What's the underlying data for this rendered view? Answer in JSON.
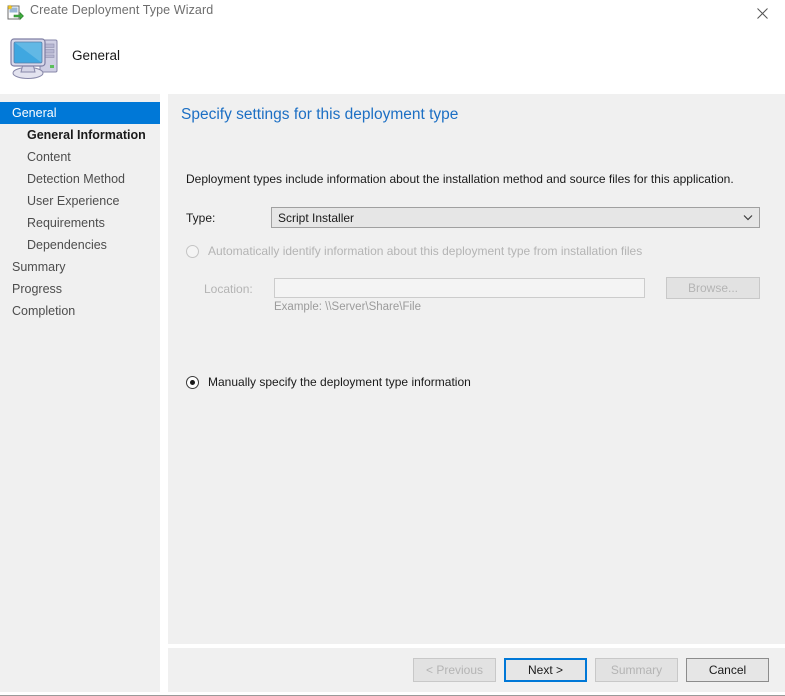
{
  "window": {
    "title": "Create Deployment Type Wizard",
    "title_icon": "wizard-document-icon",
    "close_icon": "close-icon"
  },
  "header": {
    "title": "General",
    "icon": "computer-icon"
  },
  "sidebar": {
    "items": [
      {
        "label": "General",
        "level": 0,
        "state": "selected"
      },
      {
        "label": "General Information",
        "level": 1,
        "state": "current"
      },
      {
        "label": "Content",
        "level": 1,
        "state": "normal"
      },
      {
        "label": "Detection Method",
        "level": 1,
        "state": "normal"
      },
      {
        "label": "User Experience",
        "level": 1,
        "state": "normal"
      },
      {
        "label": "Requirements",
        "level": 1,
        "state": "normal"
      },
      {
        "label": "Dependencies",
        "level": 1,
        "state": "normal"
      },
      {
        "label": "Summary",
        "level": 0,
        "state": "normal"
      },
      {
        "label": "Progress",
        "level": 0,
        "state": "normal"
      },
      {
        "label": "Completion",
        "level": 0,
        "state": "normal"
      }
    ]
  },
  "main": {
    "heading": "Specify settings for this deployment type",
    "description": "Deployment types include information about the installation method and source files for this application.",
    "type_label": "Type:",
    "type_value": "Script Installer",
    "type_arrow_icon": "chevron-down-icon",
    "auto_option": {
      "label": "Automatically identify information about this deployment type from installation files",
      "selected": false,
      "enabled": false
    },
    "location_label": "Location:",
    "location_value": "",
    "location_placeholder": "",
    "browse_label": "Browse...",
    "location_example": "Example: \\\\Server\\Share\\File",
    "manual_option": {
      "label": "Manually specify the deployment type information",
      "selected": true,
      "enabled": true
    }
  },
  "footer": {
    "previous_label": "< Previous",
    "next_label": "Next >",
    "summary_label": "Summary",
    "cancel_label": "Cancel"
  },
  "colors": {
    "accent": "#0078d7",
    "heading": "#1c6fc4",
    "panel": "#f0f0f0",
    "disabled_text": "#b4b4b4"
  }
}
